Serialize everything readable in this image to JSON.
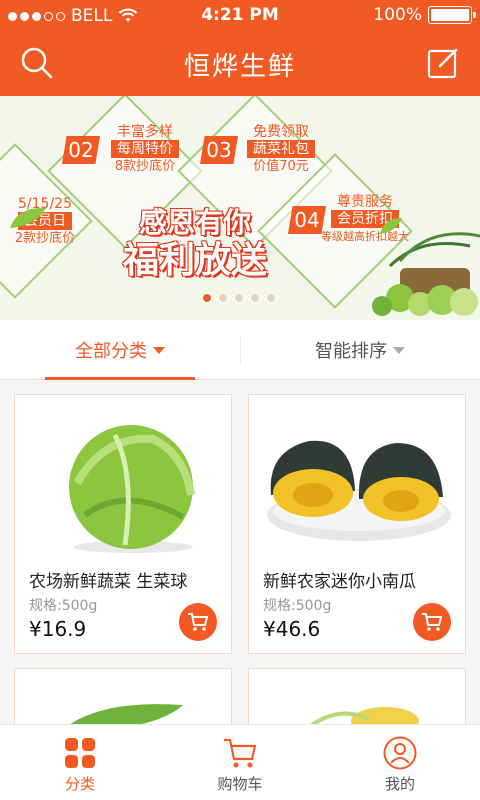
{
  "status_bar": {
    "carrier": "BELL",
    "time": "4:21 PM",
    "battery": "100%"
  },
  "nav": {
    "title": "恒烨生鲜"
  },
  "banner": {
    "promos": [
      {
        "num": "02",
        "line1": "丰富多样",
        "line2": "每周特价",
        "line3": "8款抄底价"
      },
      {
        "num": "03",
        "line1": "免费领取",
        "line2": "蔬菜礼包",
        "line3": "价值70元"
      },
      {
        "num": "",
        "line1": "5/15/25",
        "line2": "会员日",
        "line3": "2款抄底价"
      },
      {
        "num": "04",
        "line1": "尊贵服务",
        "line2": "会员折扣",
        "line3": "等级越高折扣越大"
      }
    ],
    "headline1": "感恩有你",
    "headline2": "福利放送",
    "page_count": 5,
    "active_page": 0
  },
  "filters": [
    {
      "label": "全部分类",
      "active": true
    },
    {
      "label": "智能排序",
      "active": false
    }
  ],
  "products": [
    {
      "name": "农场新鲜蔬菜 生菜球",
      "spec": "规格:500g",
      "price": "¥16.9",
      "image_icon": "lettuce-image"
    },
    {
      "name": "新鲜农家迷你小南瓜",
      "spec": "规格:500g",
      "price": "¥46.6",
      "image_icon": "pumpkin-image"
    }
  ],
  "tabs": [
    {
      "label": "分类",
      "icon": "grid-icon",
      "active": true
    },
    {
      "label": "购物车",
      "icon": "cart-icon",
      "active": false
    },
    {
      "label": "我的",
      "icon": "user-icon",
      "active": false
    }
  ],
  "colors": {
    "brand": "#f25a24",
    "banner_bg": "#f3f7ec",
    "leaf_green": "#8cc63f"
  }
}
